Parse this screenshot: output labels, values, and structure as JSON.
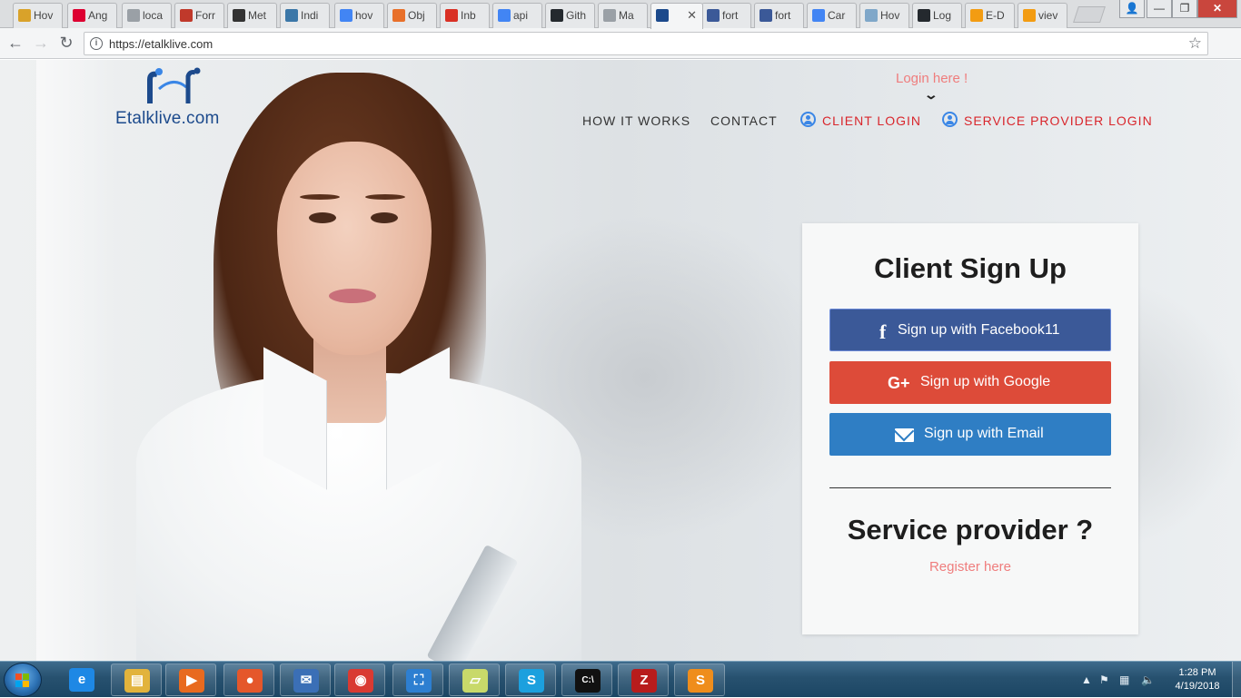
{
  "browser": {
    "tabs": [
      {
        "label": "Hov",
        "favicon": "gold-lock-icon",
        "color": "#d9a22a"
      },
      {
        "label": "Ang",
        "favicon": "angular-icon",
        "color": "#dd0031"
      },
      {
        "label": "loca",
        "favicon": "page-icon",
        "color": "#9aa0a6"
      },
      {
        "label": "Forr",
        "favicon": "red-chevron-icon",
        "color": "#c0392b"
      },
      {
        "label": "Met",
        "favicon": "h-logo-icon",
        "color": "#333333"
      },
      {
        "label": "Indi",
        "favicon": "python-icon",
        "color": "#3b77a8"
      },
      {
        "label": "hov",
        "favicon": "google-icon",
        "color": "#4285f4"
      },
      {
        "label": "Obj",
        "favicon": "orange-grid-icon",
        "color": "#e8702a"
      },
      {
        "label": "Inb",
        "favicon": "gmail-icon",
        "color": "#d93025"
      },
      {
        "label": "api",
        "favicon": "google-icon",
        "color": "#4285f4"
      },
      {
        "label": "Gith",
        "favicon": "github-icon",
        "color": "#24292e"
      },
      {
        "label": "Ma",
        "favicon": "page-icon",
        "color": "#9aa0a6"
      },
      {
        "label": "",
        "favicon": "etalk-icon",
        "color": "#1c4a8c",
        "active": true
      },
      {
        "label": "fort",
        "favicon": "facebook-icon",
        "color": "#3b5998"
      },
      {
        "label": "fort",
        "favicon": "facebook-icon",
        "color": "#3b5998"
      },
      {
        "label": "Car",
        "favicon": "google-icon",
        "color": "#4285f4"
      },
      {
        "label": "Hov",
        "favicon": "wave-icon",
        "color": "#7fa7c9"
      },
      {
        "label": "Log",
        "favicon": "github-icon",
        "color": "#24292e"
      },
      {
        "label": "E-D",
        "favicon": "orange-e-icon",
        "color": "#f39c12"
      },
      {
        "label": "viev",
        "favicon": "orange-e-icon",
        "color": "#f39c12"
      }
    ],
    "active_close": "✕",
    "url": "https://etalklive.com"
  },
  "site": {
    "logo_text": "Etalklive.com",
    "login_hint": "Login here !",
    "nav": {
      "how_it_works": "HOW IT WORKS",
      "contact": "CONTACT",
      "client_login": "CLIENT LOGIN",
      "provider_login": "SERVICE PROVIDER LOGIN"
    },
    "colors": {
      "accent_red": "#d9262c",
      "link_pink": "#ef7d7d",
      "facebook": "#3b5998",
      "google": "#dd4b39",
      "email": "#2f7ec4"
    }
  },
  "signup": {
    "title": "Client Sign Up",
    "facebook_btn": "Sign up with Facebook11",
    "google_btn": "Sign up with Google",
    "email_btn": "Sign up with Email",
    "provider_title": "Service provider ?",
    "register_link": "Register here"
  },
  "taskbar": {
    "apps": [
      {
        "name": "internet-explorer-icon",
        "glyph": "e",
        "color": "#1e88e5"
      },
      {
        "name": "file-explorer-icon",
        "glyph": "▤",
        "color": "#e2b33c"
      },
      {
        "name": "media-player-icon",
        "glyph": "▶",
        "color": "#e86a1f"
      },
      {
        "name": "firefox-icon",
        "glyph": "●",
        "color": "#e5572b"
      },
      {
        "name": "thunderbird-icon",
        "glyph": "✉",
        "color": "#3b6fb6"
      },
      {
        "name": "chrome-icon",
        "glyph": "◉",
        "color": "#d93a32"
      },
      {
        "name": "snipping-tool-icon",
        "glyph": "⛶",
        "color": "#2d7fd1"
      },
      {
        "name": "sticky-notes-icon",
        "glyph": "▱",
        "color": "#c8d96a"
      },
      {
        "name": "skype-icon",
        "glyph": "S",
        "color": "#1ca0de"
      },
      {
        "name": "command-prompt-icon",
        "glyph": "C:\\",
        "color": "#111111"
      },
      {
        "name": "filezilla-icon",
        "glyph": "Z",
        "color": "#b81c1c"
      },
      {
        "name": "sublime-text-icon",
        "glyph": "S",
        "color": "#ef8d1c"
      }
    ],
    "time": "1:28 PM",
    "date": "4/19/2018"
  }
}
